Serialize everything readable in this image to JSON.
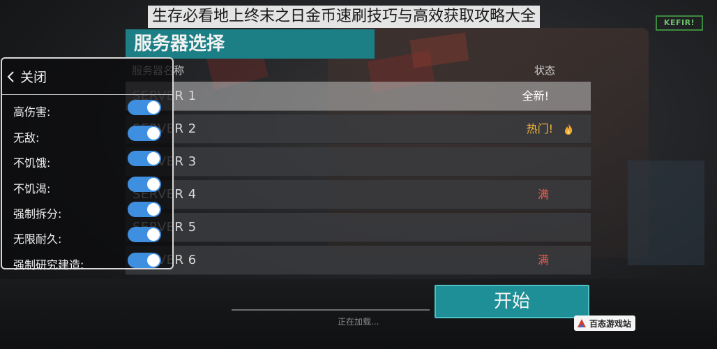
{
  "headline": "生存必看地上终末之日金币速刷技巧与高效获取攻略大全",
  "brand": "KEFIR!",
  "panel": {
    "title": "服务器选择",
    "col_name": "服务器名称",
    "col_status": "状态"
  },
  "servers": [
    {
      "name": "SERVER 1",
      "status": "全新!",
      "status_type": "new"
    },
    {
      "name": "SERVER 2",
      "status": "热门!",
      "status_type": "hot"
    },
    {
      "name": "SERVER 3",
      "status": "",
      "status_type": ""
    },
    {
      "name": "SERVER 4",
      "status": "满",
      "status_type": "full"
    },
    {
      "name": "SERVER 5",
      "status": "",
      "status_type": ""
    },
    {
      "name": "SERVER 6",
      "status": "满",
      "status_type": "full"
    }
  ],
  "cheat_menu": {
    "close_label": "关闭",
    "items": [
      {
        "label": "高伤害:",
        "on": true
      },
      {
        "label": "无敌:",
        "on": true
      },
      {
        "label": "不饥饿:",
        "on": true
      },
      {
        "label": "不饥渴:",
        "on": true
      },
      {
        "label": "强制拆分:",
        "on": true
      },
      {
        "label": "无限耐久:",
        "on": true
      },
      {
        "label": "强制研究建造:",
        "on": true
      }
    ]
  },
  "start_label": "开始",
  "loading_text": "正在加载...",
  "site_name": "百态游戏站",
  "colors": {
    "accent": "#1d7f86",
    "toggle_on": "#3f8fe0",
    "hot": "#f2b53a",
    "full": "#e35a4e"
  },
  "icons": {
    "back": "chevron-left-icon",
    "hot": "fire-icon"
  }
}
